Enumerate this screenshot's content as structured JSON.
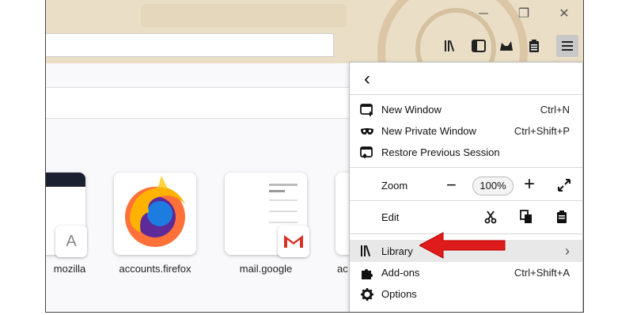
{
  "window": {
    "controls": {
      "minimize": "─",
      "restore": "❐",
      "close": "✕"
    }
  },
  "toolbar": {
    "buttons": [
      "library-icon",
      "sidebar-icon",
      "fox-icon",
      "clipboard-icon",
      "hamburger-menu-icon"
    ]
  },
  "tiles": [
    {
      "label": "mozilla",
      "badge": "A"
    },
    {
      "label": "accounts.firefox"
    },
    {
      "label": "mail.google",
      "badge": "M"
    },
    {
      "label": "ac"
    }
  ],
  "menu": {
    "back_glyph": "‹",
    "items": [
      {
        "label": "New Window",
        "shortcut": "Ctrl+N"
      },
      {
        "label": "New Private Window",
        "shortcut": "Ctrl+Shift+P"
      },
      {
        "label": "Restore Previous Session",
        "shortcut": ""
      }
    ],
    "zoom": {
      "label": "Zoom",
      "minus": "−",
      "value": "100%",
      "plus": "+"
    },
    "edit": {
      "label": "Edit"
    },
    "library": {
      "label": "Library",
      "chevron": "›"
    },
    "addons": {
      "label": "Add-ons",
      "shortcut": "Ctrl+Shift+A"
    },
    "options": {
      "label": "Options"
    }
  },
  "colors": {
    "arrow": "#e01b1b",
    "accent_orange": "#ff7139"
  }
}
